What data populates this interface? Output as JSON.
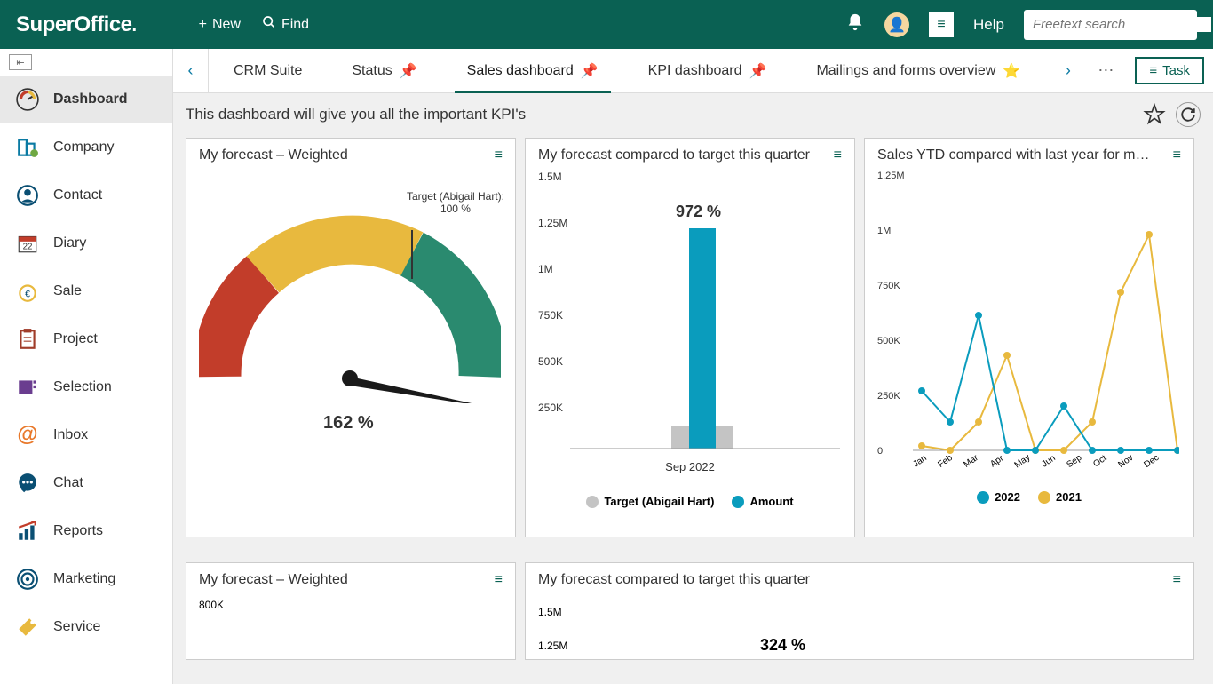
{
  "topbar": {
    "logo": "SuperOffice",
    "new": "New",
    "find": "Find",
    "help": "Help",
    "search_placeholder": "Freetext search"
  },
  "sidebar": {
    "items": [
      {
        "label": "Dashboard"
      },
      {
        "label": "Company"
      },
      {
        "label": "Contact"
      },
      {
        "label": "Diary"
      },
      {
        "label": "Sale"
      },
      {
        "label": "Project"
      },
      {
        "label": "Selection"
      },
      {
        "label": "Inbox"
      },
      {
        "label": "Chat"
      },
      {
        "label": "Reports"
      },
      {
        "label": "Marketing"
      },
      {
        "label": "Service"
      }
    ],
    "calendar_day": "22"
  },
  "tabs": {
    "items": [
      {
        "label": "CRM Suite"
      },
      {
        "label": "Status"
      },
      {
        "label": "Sales dashboard"
      },
      {
        "label": "KPI dashboard"
      },
      {
        "label": "Mailings and forms overview"
      }
    ],
    "task": "Task"
  },
  "subtitle": "This dashboard will give you all the important KPI's",
  "tiles": {
    "t1": {
      "title": "My forecast – Weighted",
      "target_label": "Target (Abigail Hart):\n100 %",
      "value": "162 %"
    },
    "t2": {
      "title": "My forecast compared to target this quarter",
      "pct": "972 %",
      "xlabel": "Sep 2022",
      "legend_target": "Target (Abigail Hart)",
      "legend_amount": "Amount",
      "axis": [
        "1.5M",
        "1.25M",
        "1M",
        "750K",
        "500K",
        "250K"
      ]
    },
    "t3": {
      "title": "Sales YTD compared with last year for my gr...",
      "legend_2022": "2022",
      "legend_2021": "2021",
      "axis": [
        "1.25M",
        "1M",
        "750K",
        "500K",
        "250K",
        "0"
      ],
      "months": [
        "Jan",
        "Feb",
        "Mar",
        "Apr",
        "May",
        "Jun",
        "Sep",
        "Oct",
        "Nov",
        "Dec"
      ]
    },
    "t4": {
      "title": "My forecast – Weighted",
      "axis0": "800K"
    },
    "t5": {
      "title": "My forecast compared to target this quarter",
      "axis0": "1.5M",
      "axis1": "1.25M",
      "pct": "324 %"
    }
  },
  "chart_data": [
    {
      "type": "gauge",
      "title": "My forecast – Weighted",
      "value_pct": 162,
      "target_label": "Target (Abigail Hart)",
      "target_pct": 100,
      "ranges": [
        {
          "color": "#c23d2a",
          "from": 0,
          "to": 50
        },
        {
          "color": "#e8b93e",
          "from": 50,
          "to": 100
        },
        {
          "color": "#2a8a6f",
          "from": 100,
          "to": 200
        }
      ]
    },
    {
      "type": "bar",
      "title": "My forecast compared to target this quarter",
      "categories": [
        "Sep 2022"
      ],
      "series": [
        {
          "name": "Target (Abigail Hart)",
          "values": [
            125000
          ],
          "color": "#c4c4c4"
        },
        {
          "name": "Amount",
          "values": [
            1200000
          ],
          "color": "#0a9cbd"
        }
      ],
      "value_pct": 972,
      "ylim": [
        0,
        1500000
      ],
      "yticks": [
        "250K",
        "500K",
        "750K",
        "1M",
        "1.25M",
        "1.5M"
      ]
    },
    {
      "type": "line",
      "title": "Sales YTD compared with last year for my group",
      "categories": [
        "Jan",
        "Feb",
        "Mar",
        "Apr",
        "May",
        "Jun",
        "Sep",
        "Oct",
        "Nov",
        "Dec"
      ],
      "series": [
        {
          "name": "2022",
          "color": "#0a9cbd",
          "values": [
            270000,
            130000,
            610000,
            0,
            0,
            200000,
            0,
            0,
            0,
            0
          ]
        },
        {
          "name": "2021",
          "color": "#e8b93e",
          "values": [
            20000,
            0,
            130000,
            430000,
            0,
            0,
            130000,
            720000,
            980000,
            0
          ]
        }
      ],
      "ylim": [
        0,
        1250000
      ],
      "yticks": [
        "0",
        "250K",
        "500K",
        "750K",
        "1M",
        "1.25M"
      ]
    }
  ]
}
